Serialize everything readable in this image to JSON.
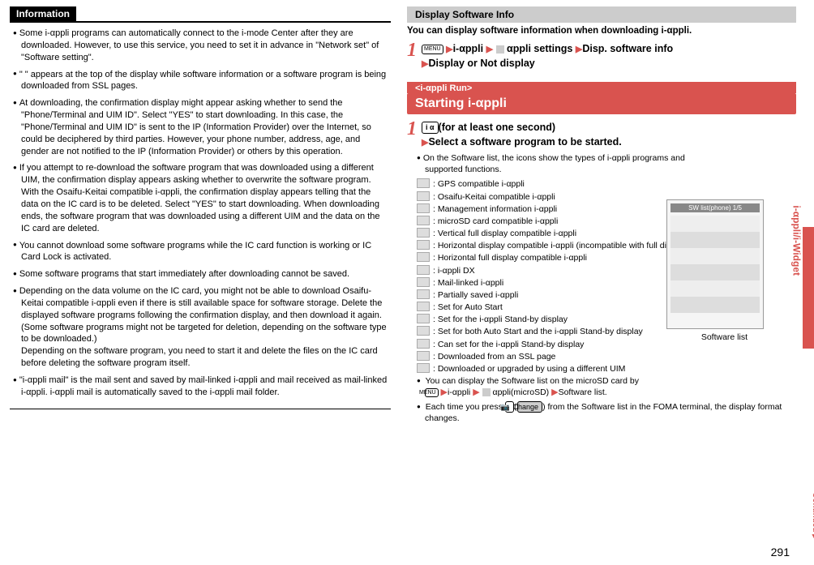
{
  "left": {
    "info_title": "Information",
    "items": [
      "Some i-αppli programs can automatically connect to the i-mode Center after they are downloaded. However, to use this service, you need to set it in advance in \"Network set\" of \"Software setting\".",
      "\" \" appears at the top of the display while software information or a software program is being downloaded from SSL pages.",
      "At downloading, the confirmation display might appear asking whether to send the \"Phone/Terminal and UIM ID\". Select \"YES\" to start downloading. In this case, the \"Phone/Terminal and UIM ID\" is sent to the IP (Information Provider) over the Internet, so could be deciphered by third parties. However, your phone number, address, age, and gender are not notified to the IP (Information Provider) or others by this operation.",
      "If you attempt to re-download the software program that was downloaded using a different UIM, the confirmation display appears asking whether to overwrite the software program. With the Osaifu-Keitai compatible i-αppli, the confirmation display appears telling that the data on the IC card is to be deleted. Select \"YES\" to start downloading. When downloading ends, the software program that was downloaded using a different UIM and the data on the IC card are deleted.",
      "You cannot download some software programs while the IC card function is working or IC Card Lock is activated.",
      "Some software programs that start immediately after downloading cannot be saved.",
      "Depending on the data volume on the IC card, you might not be able to download Osaifu-Keitai compatible i-αppli even if there is still available space for software storage. Delete the displayed software programs following the confirmation display, and then download it again. (Some software programs might not be targeted for deletion, depending on the software type to be downloaded.)\nDepending on the software program, you need to start it and delete the files on the IC card before deleting the software program itself.",
      "\"i-αppli mail\" is the mail sent and saved by mail-linked i-αppli and mail received as mail-linked i-αppli. i-αppli mail is automatically saved to the i-αppli mail folder."
    ]
  },
  "right": {
    "sub_header": "Display Software Info",
    "intro": "You can display software information when downloading i-αppli.",
    "step1_btn": "MENU",
    "step1_a": "i-αppli",
    "step1_b": "αppli settings",
    "step1_c": "Disp. software info",
    "step1_d": "Display or Not display",
    "section_header": "Starting i-αppli",
    "section_tag": "<i-αppli Run>",
    "step1b_a": "(for at least one second)",
    "step1b_b": "Select a software program to be started.",
    "list_intro": "On the Software list, the icons show the types of i-αppli programs and supported functions.",
    "icons": [
      ": GPS compatible i-αppli",
      ": Osaifu-Keitai compatible i-αppli",
      ": Management information i-αppli",
      ": microSD card compatible i-αppli",
      ": Vertical full display compatible i-αppli",
      ": Horizontal display compatible i-αppli (incompatible with full display)",
      ": Horizontal full display compatible i-αppli",
      ": i-αppli DX",
      ": Mail-linked i-αppli",
      ": Partially saved i-αppli",
      ": Set for Auto Start",
      ": Set for the i-αppli Stand-by display",
      ": Set for both Auto Start and the i-αppli Stand-by display",
      ": Can set for the i-αppli Stand-by display",
      ": Downloaded from an SSL page",
      ": Downloaded or upgraded by using a different UIM"
    ],
    "note1_prefix": "You can display the Software list on the microSD card by",
    "note1_btn": "MENU",
    "note1_a": "i-αppli",
    "note1_b": "αppli(microSD)",
    "note1_c": "Software list.",
    "note2_a": "Each time you press ",
    "note2_btn": "📷",
    "note2_change": "Change",
    "note2_b": " from the Software list in the FOMA terminal, the display format changes.",
    "sw_caption": "Software list",
    "sw_img_title": "SW list(phone) 1/5"
  },
  "side_tab": "i-αppli/i-Widget",
  "page_num": "291",
  "continued": "Continued"
}
